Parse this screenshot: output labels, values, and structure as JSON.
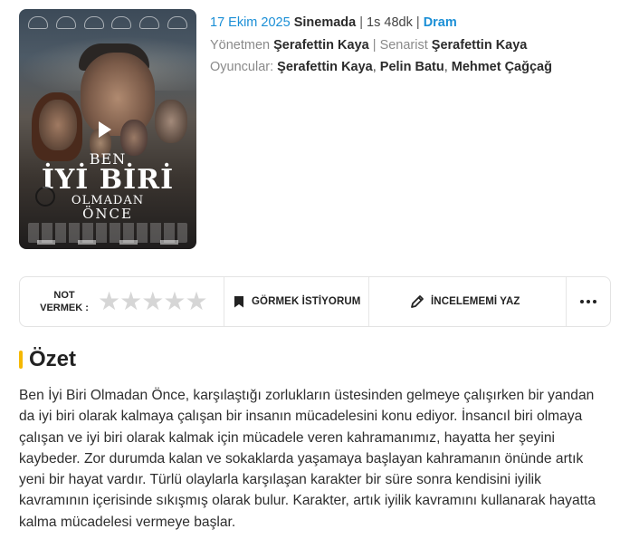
{
  "movie": {
    "date": "17 Ekim 2025",
    "status": "Sinemada",
    "separator": "|",
    "duration": "1s 48dk",
    "genre": "Dram",
    "director_label": "Yönetmen",
    "director": "Şerafettin Kaya",
    "writer_label": "Senarist",
    "writer": "Şerafettin Kaya",
    "cast_label": "Oyuncular:",
    "cast": [
      "Şerafettin Kaya",
      "Pelin Batu",
      "Mehmet Çağçağ"
    ]
  },
  "poster": {
    "title_line1": "BEN",
    "title_line2": "İYİ BİRİ",
    "title_line3": "OLMADAN",
    "title_line4": "ÖNCE",
    "play_icon": "play-icon"
  },
  "actions": {
    "rate_label_1": "NOT",
    "rate_label_2": "VERMEK :",
    "rating_value": 0,
    "star_count": 5,
    "watchlist_label": "GÖRMEK İSTİYORUM",
    "review_label": "İNCELEMEMİ YAZ",
    "more_icon": "more-dots-icon"
  },
  "summary": {
    "title": "Özet",
    "text": "Ben İyi Biri Olmadan Önce, karşılaştığı zorlukların üstesinden gelmeye çalışırken bir yandan da iyi biri olarak kalmaya çalışan bir insanın mücadelesini konu ediyor. İnsancıl biri olmaya çalışan ve iyi biri olarak kalmak için mücadele veren kahramanımız, hayatta her şeyini kaybeder. Zor durumda kalan ve sokaklarda yaşamaya başlayan kahramanın önünde artık yeni bir hayat vardır. Türlü olaylarla karşılaşan karakter bir süre sonra kendisini iyilik kavramının içerisinde sıkışmış olarak bulur. Karakter, artık iyilik kavramını kullanarak hayatta kalma mücadelesi vermeye başlar."
  },
  "colors": {
    "accent": "#f5b800",
    "link": "#1b8fd6",
    "star_empty": "#d6d6d6"
  }
}
